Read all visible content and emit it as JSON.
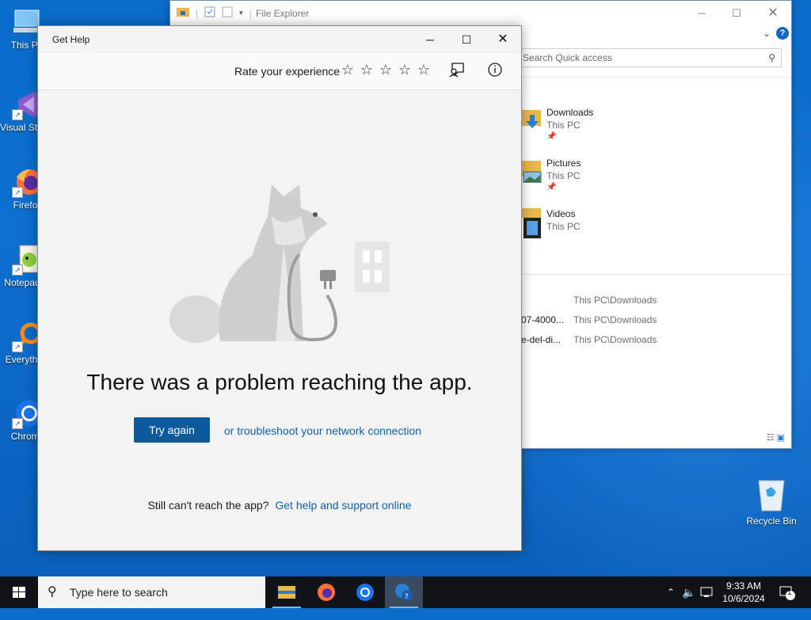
{
  "desktop": {
    "icons": [
      {
        "label": "This PC"
      },
      {
        "label": "Visual Studio 2017"
      },
      {
        "label": "Firefox"
      },
      {
        "label": "Notepad++"
      },
      {
        "label": "Everything"
      },
      {
        "label": "Chrome"
      }
    ],
    "recycle_bin": "Recycle Bin"
  },
  "file_explorer": {
    "title": "File Explorer",
    "search_placeholder": "Search Quick access",
    "quick_access": [
      {
        "name": "Downloads",
        "location": "This PC"
      },
      {
        "name": "Pictures",
        "location": "This PC"
      },
      {
        "name": "Videos",
        "location": "This PC"
      }
    ],
    "recent_files": [
      {
        "name": "",
        "location": "This PC\\Downloads"
      },
      {
        "name": "07-4000...",
        "location": "This PC\\Downloads"
      },
      {
        "name": "e-del-di...",
        "location": "This PC\\Downloads"
      }
    ]
  },
  "get_help": {
    "title": "Get Help",
    "rate_label": "Rate your experience",
    "rating": {
      "value": 0,
      "max": 5
    },
    "headline": "There was a problem reaching the app.",
    "try_again": "Try again",
    "troubleshoot_link": "or troubleshoot your network connection",
    "still_text": "Still can't reach the app?",
    "support_link": "Get help and support online"
  },
  "taskbar": {
    "search_placeholder": "Type here to search",
    "time": "9:33 AM",
    "date": "10/6/2024",
    "notification_count": "1"
  },
  "colors": {
    "accent": "#0b5a9e",
    "link": "#0d62b0",
    "desktop": "#0a6cc9",
    "taskbar": "#101419"
  }
}
